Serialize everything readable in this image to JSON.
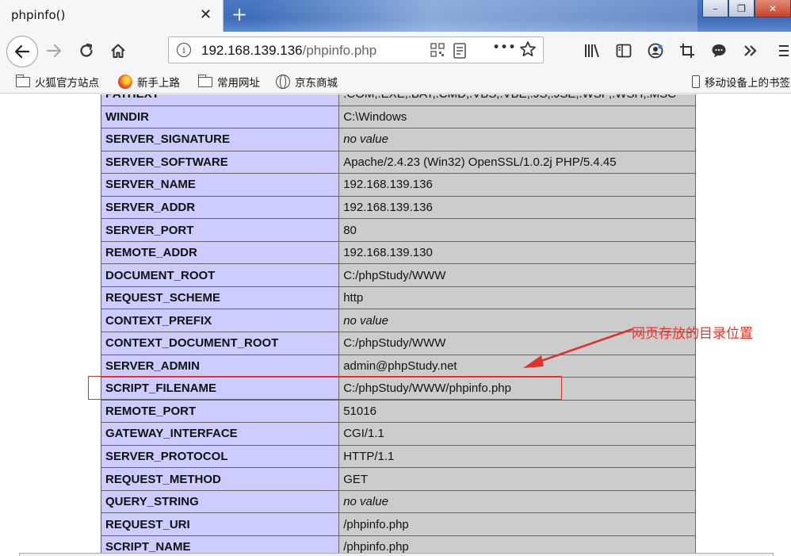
{
  "window": {
    "tab_title": "phpinfo()",
    "tab_close": "✕",
    "new_tab": "+",
    "controls": {
      "minimize": "–",
      "maximize": "❐",
      "close": "✕"
    }
  },
  "navbar": {
    "url_host": "192.168.139.136",
    "url_path": "/phpinfo.php",
    "more_label": "•••"
  },
  "bookmarks": [
    {
      "label": "火狐官方站点",
      "icon": "folder-icon"
    },
    {
      "label": "新手上路",
      "icon": "firefox-icon"
    },
    {
      "label": "常用网址",
      "icon": "folder-icon"
    },
    {
      "label": "京东商城",
      "icon": "globe-icon"
    }
  ],
  "mobile_bookmarks": "移动设备上的书签",
  "phpinfo": {
    "rows": [
      {
        "key": "PATHEXT",
        "value": ".COM;.EXE;.BAT;.CMD;.VBS;.VBE;.JS;.JSE;.WSF;.WSH;.MSC",
        "no_value": false
      },
      {
        "key": "WINDIR",
        "value": "C:\\Windows",
        "no_value": false
      },
      {
        "key": "SERVER_SIGNATURE",
        "value": "no value",
        "no_value": true
      },
      {
        "key": "SERVER_SOFTWARE",
        "value": "Apache/2.4.23 (Win32) OpenSSL/1.0.2j PHP/5.4.45",
        "no_value": false
      },
      {
        "key": "SERVER_NAME",
        "value": "192.168.139.136",
        "no_value": false
      },
      {
        "key": "SERVER_ADDR",
        "value": "192.168.139.136",
        "no_value": false
      },
      {
        "key": "SERVER_PORT",
        "value": "80",
        "no_value": false
      },
      {
        "key": "REMOTE_ADDR",
        "value": "192.168.139.130",
        "no_value": false
      },
      {
        "key": "DOCUMENT_ROOT",
        "value": "C:/phpStudy/WWW",
        "no_value": false
      },
      {
        "key": "REQUEST_SCHEME",
        "value": "http",
        "no_value": false
      },
      {
        "key": "CONTEXT_PREFIX",
        "value": "no value",
        "no_value": true
      },
      {
        "key": "CONTEXT_DOCUMENT_ROOT",
        "value": "C:/phpStudy/WWW",
        "no_value": false
      },
      {
        "key": "SERVER_ADMIN",
        "value": "admin@phpStudy.net",
        "no_value": false
      },
      {
        "key": "SCRIPT_FILENAME",
        "value": "C:/phpStudy/WWW/phpinfo.php",
        "no_value": false
      },
      {
        "key": "REMOTE_PORT",
        "value": "51016",
        "no_value": false
      },
      {
        "key": "GATEWAY_INTERFACE",
        "value": "CGI/1.1",
        "no_value": false
      },
      {
        "key": "SERVER_PROTOCOL",
        "value": "HTTP/1.1",
        "no_value": false
      },
      {
        "key": "REQUEST_METHOD",
        "value": "GET",
        "no_value": false
      },
      {
        "key": "QUERY_STRING",
        "value": "no value",
        "no_value": true
      },
      {
        "key": "REQUEST_URI",
        "value": "/phpinfo.php",
        "no_value": false
      },
      {
        "key": "SCRIPT_NAME",
        "value": "/phpinfo.php",
        "no_value": false
      }
    ]
  },
  "annotation": {
    "text": "网页存放的目录位置",
    "color": "#ff2b22"
  },
  "colors": {
    "key_cell": "#ccccff",
    "value_cell": "#cccccc"
  }
}
